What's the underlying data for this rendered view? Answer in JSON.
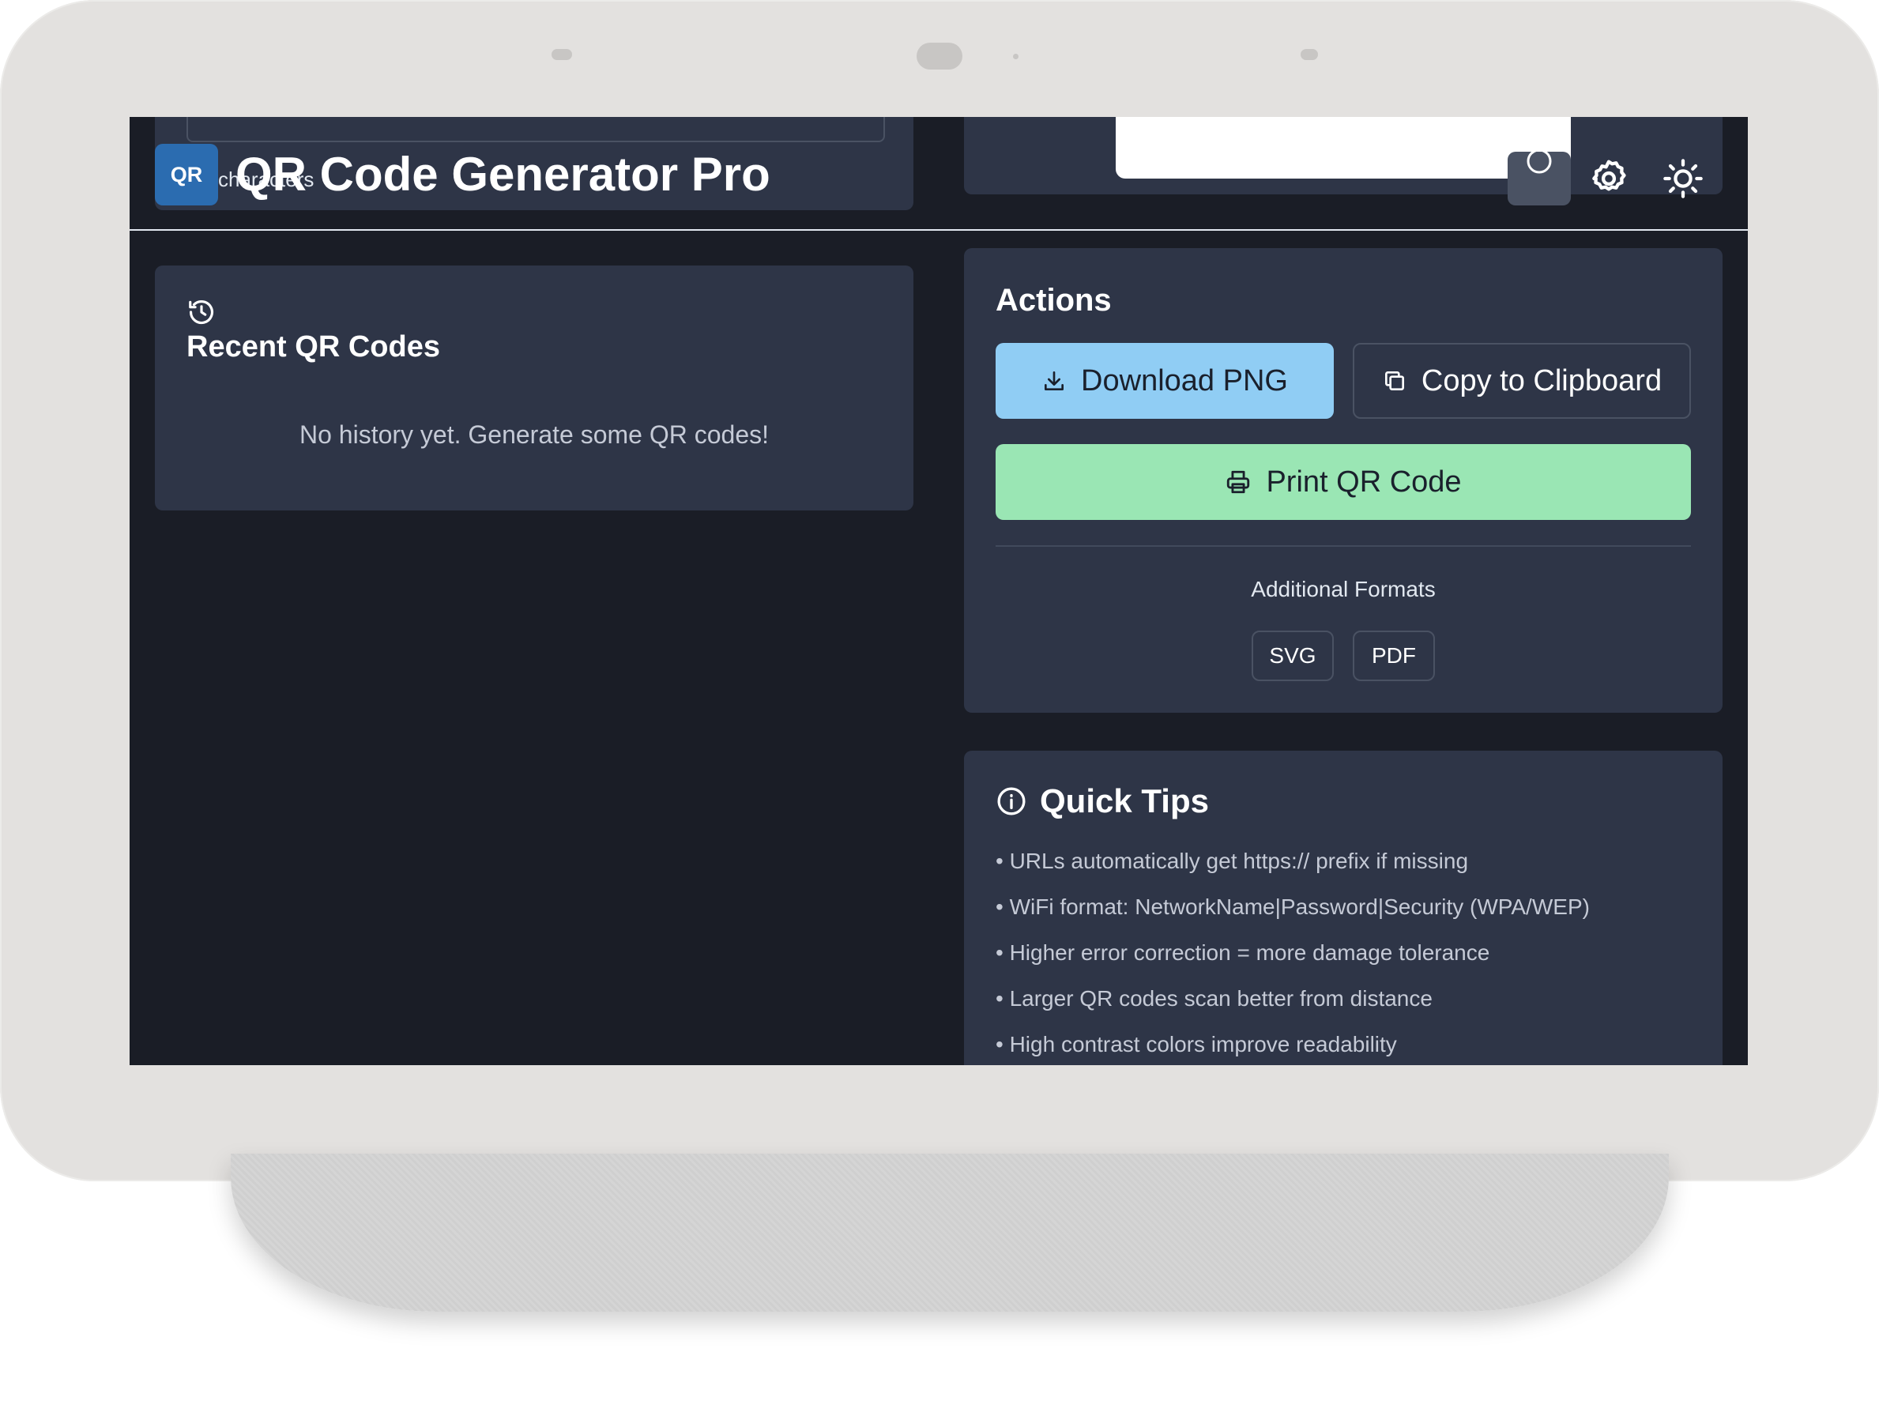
{
  "app": {
    "logo_text": "QR",
    "title": "QR Code Generator Pro",
    "behind_text": "characters"
  },
  "header": {
    "icons": [
      "circle-icon",
      "gear-icon",
      "sun-icon"
    ]
  },
  "history": {
    "icon": "history-icon",
    "title": "Recent QR Codes",
    "empty_text": "No history yet. Generate some QR codes!"
  },
  "actions": {
    "title": "Actions",
    "download_label": "Download PNG",
    "copy_label": "Copy to Clipboard",
    "print_label": "Print QR Code",
    "additional_label": "Additional Formats",
    "formats": [
      "SVG",
      "PDF"
    ]
  },
  "tips": {
    "title": "Quick Tips",
    "items": [
      "• URLs automatically get https:// prefix if missing",
      "• WiFi format: NetworkName|Password|Security (WPA/WEP)",
      "• Higher error correction = more damage tolerance",
      "• Larger QR codes scan better from distance",
      "• High contrast colors improve readability"
    ]
  },
  "colors": {
    "bg": "#1a1d26",
    "card": "#2e3547",
    "download": "#90cdf4",
    "print": "#9ae6b4",
    "logo": "#2b6cb0"
  }
}
